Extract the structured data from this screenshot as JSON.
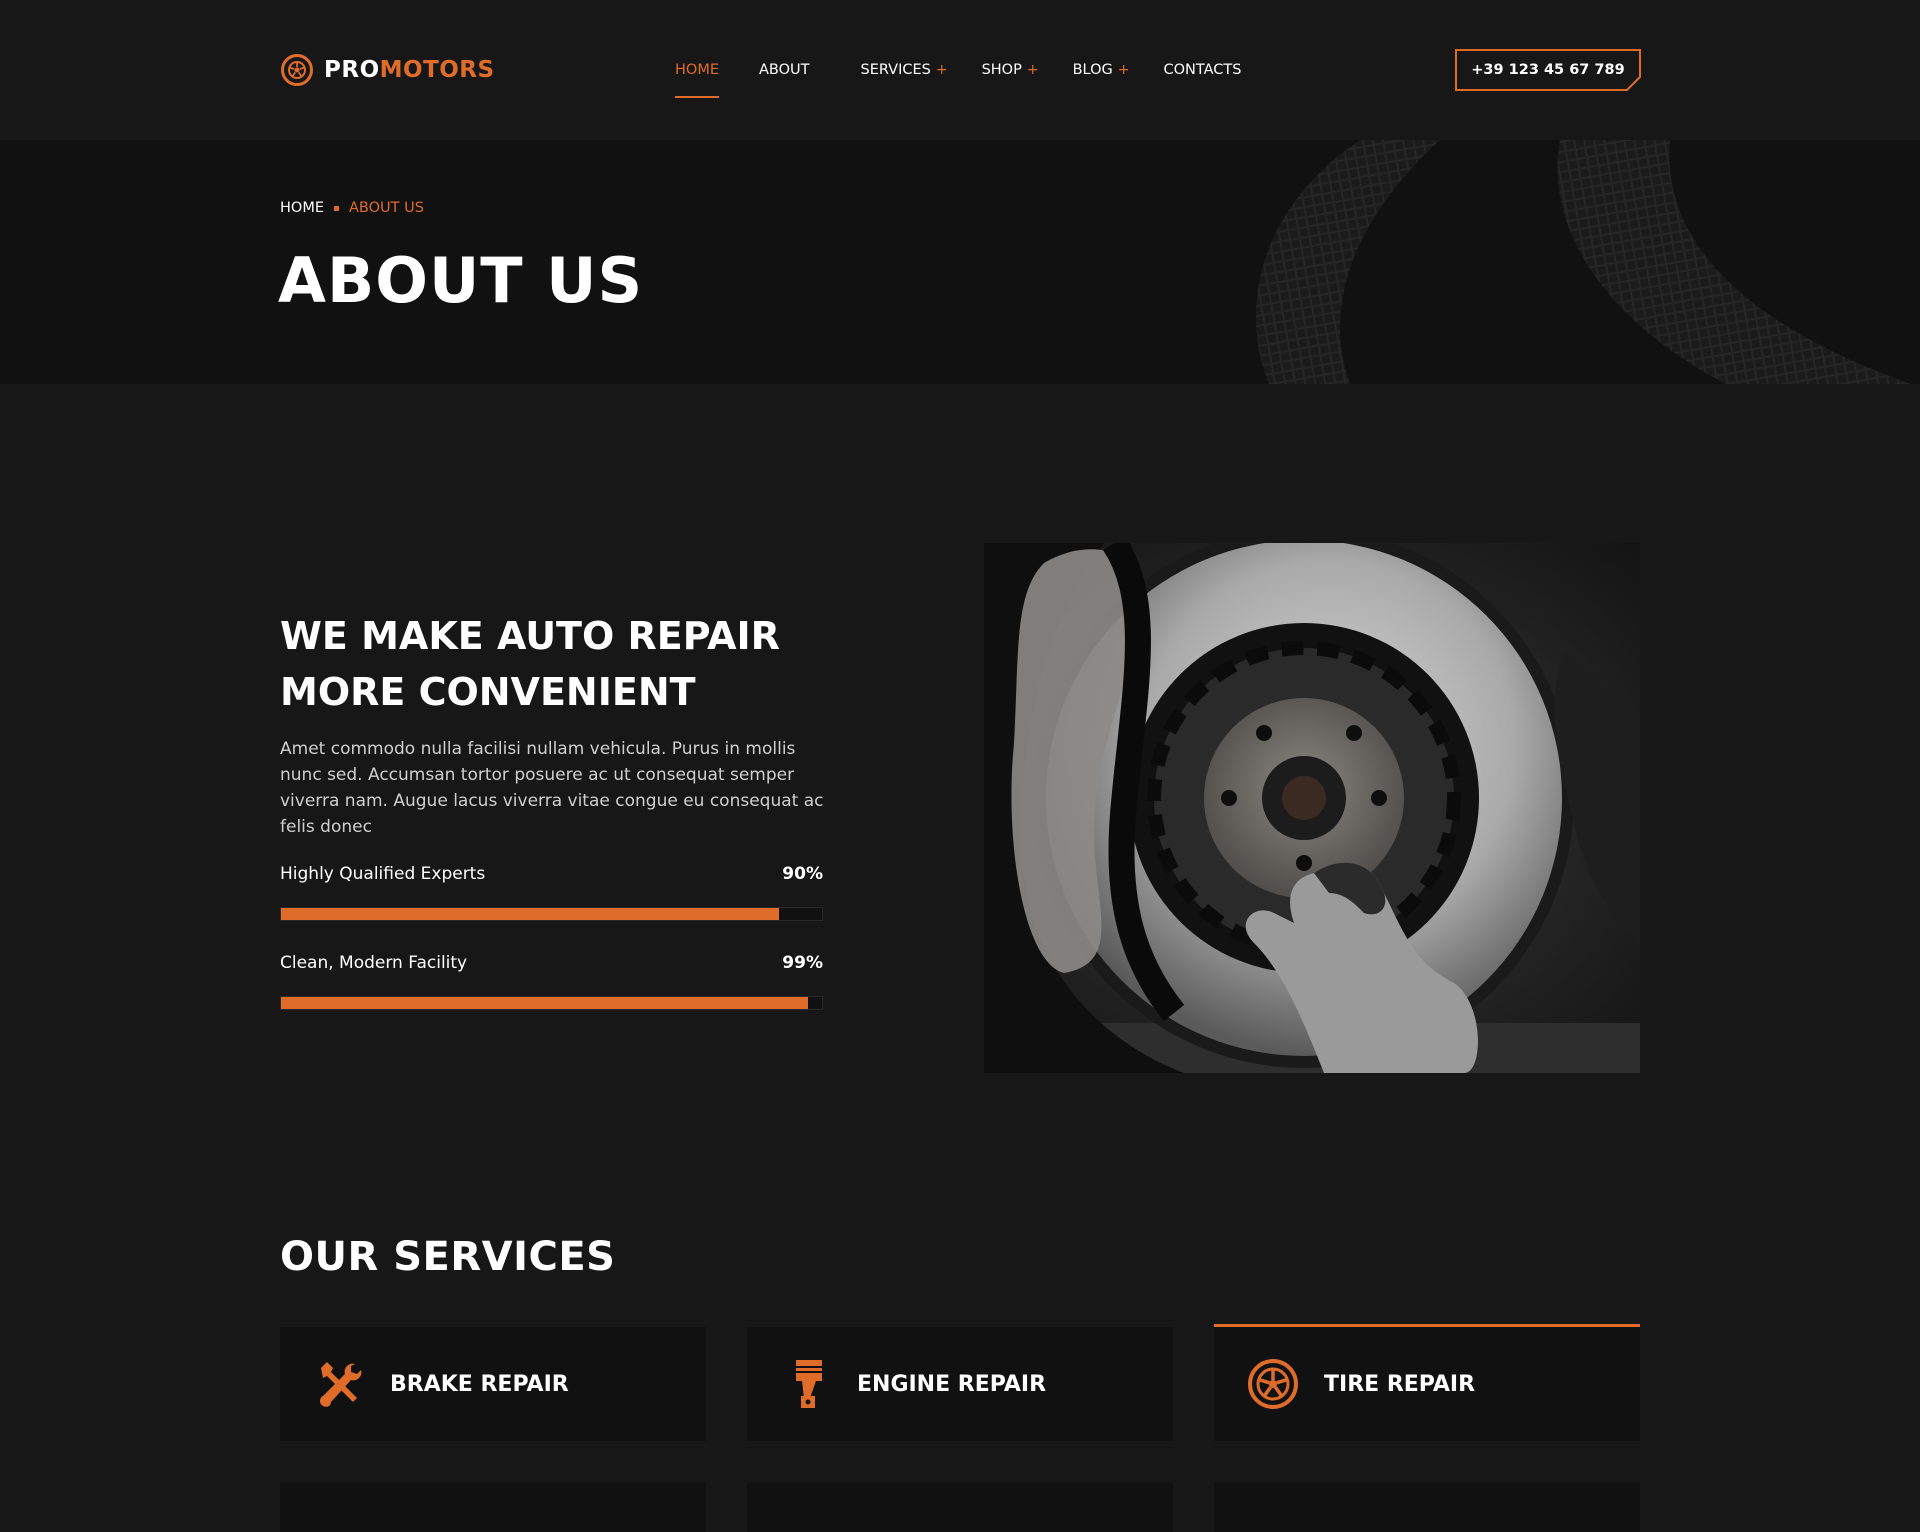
{
  "brand": {
    "part1": "PRO",
    "part2": "MOTORS",
    "accent": "#e06c2a"
  },
  "nav": {
    "items": [
      {
        "label": "HOME",
        "active": true,
        "has_submenu": false
      },
      {
        "label": "ABOUT",
        "active": false,
        "has_submenu": false
      },
      {
        "label": "SERVICES",
        "active": false,
        "has_submenu": true
      },
      {
        "label": "SHOP",
        "active": false,
        "has_submenu": true
      },
      {
        "label": "BLOG",
        "active": false,
        "has_submenu": true
      },
      {
        "label": "CONTACTS",
        "active": false,
        "has_submenu": false
      }
    ],
    "submenu_marker": "+"
  },
  "phone": "+39 123 45 67 789",
  "hero": {
    "breadcrumb": {
      "home": "HOME",
      "current": "ABOUT US"
    },
    "title": "ABOUT US"
  },
  "about": {
    "heading_line1": "WE MAKE AUTO REPAIR",
    "heading_line2": "MORE CONVENIENT",
    "text": "Amet commodo nulla facilisi nullam vehicula. Purus in mollis nunc sed. Accumsan tortor posuere ac ut consequat semper viverra nam. Augue lacus viverra vitae congue eu consequat ac felis donec",
    "skills": [
      {
        "label": "Highly Qualified Experts",
        "percent_label": "90%",
        "value": 0.92
      },
      {
        "label": "Clean, Modern Facility",
        "percent_label": "99%",
        "value": 0.975
      }
    ]
  },
  "services": {
    "title": "OUR SERVICES",
    "items": [
      {
        "label": "BRAKE REPAIR",
        "icon": "wrench-screwdriver-icon"
      },
      {
        "label": "ENGINE REPAIR",
        "icon": "piston-icon"
      },
      {
        "label": "TIRE REPAIR",
        "icon": "wheel-icon",
        "active": true
      }
    ]
  }
}
